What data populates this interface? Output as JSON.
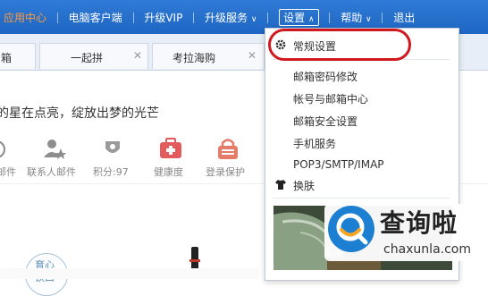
{
  "topbar": {
    "app_center": "应用中心",
    "pc_client": "电脑客户端",
    "upgrade_vip": "升级VIP",
    "upgrade_service": "升级服务",
    "settings": "设置",
    "help": "帮助",
    "logout": "退出"
  },
  "tabs": [
    {
      "label": "箱"
    },
    {
      "label": "一起拼"
    },
    {
      "label": "考拉海购"
    }
  ],
  "slogan": "的星在点亮，绽放出梦的光芒",
  "icon_row": [
    {
      "label": "邮件",
      "icon": "mail-icon"
    },
    {
      "label": "联系人邮件",
      "icon": "contact-star-icon"
    },
    {
      "label": "积分:97",
      "icon": "points-badge-icon"
    },
    {
      "label": "健康度",
      "icon": "health-kit-icon"
    },
    {
      "label": "登录保护",
      "icon": "login-protect-icon"
    }
  ],
  "dropdown": {
    "items": [
      {
        "label": "常规设置",
        "icon": "gear-icon"
      },
      {
        "label": "邮箱密码修改"
      },
      {
        "label": "帐号与邮箱中心"
      },
      {
        "label": "邮箱安全设置"
      },
      {
        "label": "手机服务"
      },
      {
        "label": "POP3/SMTP/IMAP"
      },
      {
        "label": "换肤",
        "icon": "tshirt-icon"
      }
    ]
  },
  "badge": {
    "line1": "育心",
    "line2": "饮口"
  },
  "watermark": {
    "text": "查询啦",
    "url": "chaxunla.com"
  },
  "colors": {
    "topbar": "#2467c8",
    "highlight_ring": "#d0181f",
    "app_center": "#ff9a3d",
    "health_icon": "#e35b5b",
    "login_icon": "#e57c6a"
  }
}
